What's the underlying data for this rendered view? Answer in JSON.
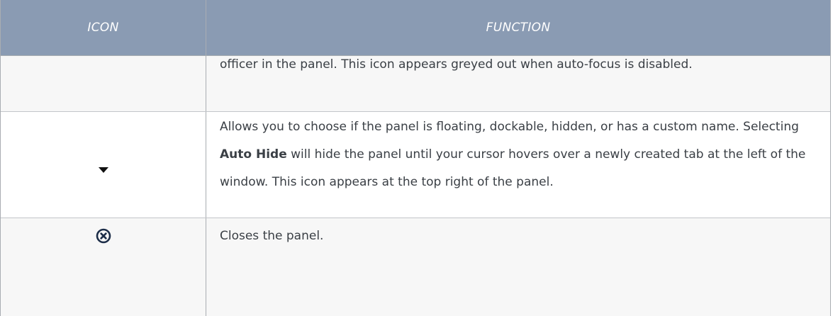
{
  "table": {
    "headers": {
      "icon": "ICON",
      "function": "FUNCTION"
    },
    "rows": [
      {
        "icon": "",
        "function": "officer in the panel. This icon appears greyed out when auto-focus is disabled."
      },
      {
        "icon": "caret-down-icon",
        "function_parts": [
          "Allows you to choose if the panel is floating, dockable, hidden, or has a custom name. Selecting ",
          "Auto Hide",
          " will hide the panel until your cursor hovers over a newly created tab at the left of the window. This icon appears at the top right of the panel."
        ]
      },
      {
        "icon": "close-circle-icon",
        "function": "Closes the panel."
      }
    ]
  },
  "colors": {
    "header_bg": "#8a9bb3",
    "header_text": "#ffffff",
    "alt_row_bg": "#f7f7f7",
    "icon_dark": "#1c2d48"
  }
}
